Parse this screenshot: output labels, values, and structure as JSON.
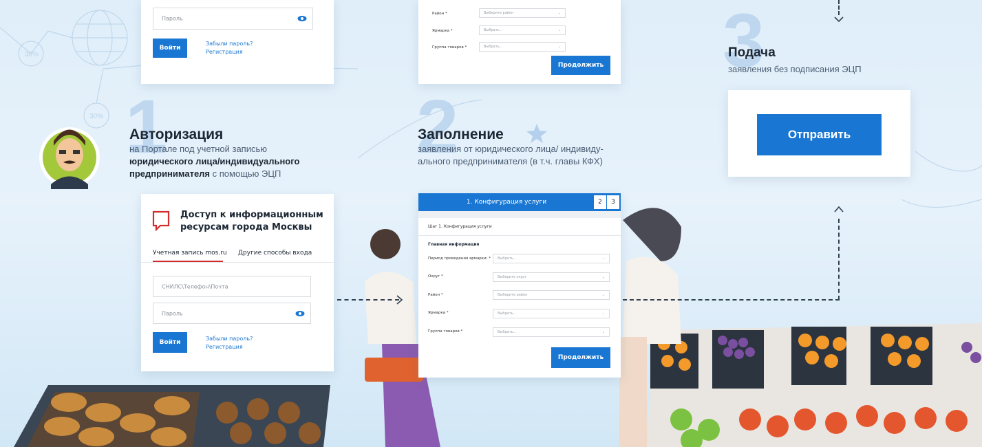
{
  "login_top": {
    "password_placeholder": "Пароль",
    "login_button": "Войти",
    "forgot_link": "Забыли пароль?",
    "register_link": "Регистрация"
  },
  "form_top": {
    "rows": [
      {
        "label": "Район *",
        "value": "Выберите район"
      },
      {
        "label": "Ярмарка *",
        "value": "Выбрать..."
      },
      {
        "label": "Группа товаров *",
        "value": "Выбрать..."
      }
    ],
    "continue_button": "Продолжить"
  },
  "steps": {
    "one": {
      "number": "1",
      "title": "Авторизация",
      "line1": "на Портале под учетной записью",
      "line2_bold": "юридического лица/индивидуального",
      "line3_bold": "предпринимателя",
      "line3_rest": " с помощью ЭЦП"
    },
    "two": {
      "number": "2",
      "title": "Заполнение",
      "line1": "заявления от юридического лица/ индивиду-",
      "line2": "ального предпринимателя (в т.ч. главы КФХ)"
    },
    "three": {
      "number": "3",
      "title": "Подача",
      "line1": "заявления без подписания ЭЦП"
    }
  },
  "login_main": {
    "title_line1": "Доступ к информационным",
    "title_line2": "ресурсам города Москвы",
    "tab_active": "Учетная запись mos.ru",
    "tab_other": "Другие способы входа",
    "login_placeholder": "СНИЛС\\Телефон\\Почта",
    "password_placeholder": "Пароль",
    "login_button": "Войти",
    "forgot_link": "Забыли пароль?",
    "register_link": "Регистрация"
  },
  "form_main": {
    "header_step": "1. Конфигурация услуги",
    "step_2": "2",
    "step_3": "3",
    "step_caption": "Шаг 1. Конфигурация услуги",
    "section_title": "Главная информация",
    "rows": [
      {
        "label": "Период проведения ярмарки: *",
        "value": "Выбрать..."
      },
      {
        "label": "Округ *",
        "value": "Выберите округ"
      },
      {
        "label": "Район *",
        "value": "Выберите район"
      },
      {
        "label": "Ярмарка *",
        "value": "Выбрать..."
      },
      {
        "label": "Группа товаров *",
        "value": "Выбрать..."
      }
    ],
    "continue_button": "Продолжить"
  },
  "submit_card": {
    "button": "Отправить"
  },
  "decor": {
    "percent_a": "30%",
    "percent_b": "30%"
  },
  "colors": {
    "accent": "#1976d2",
    "text_dark": "#1c2734",
    "logo_red": "#d22c2c"
  }
}
